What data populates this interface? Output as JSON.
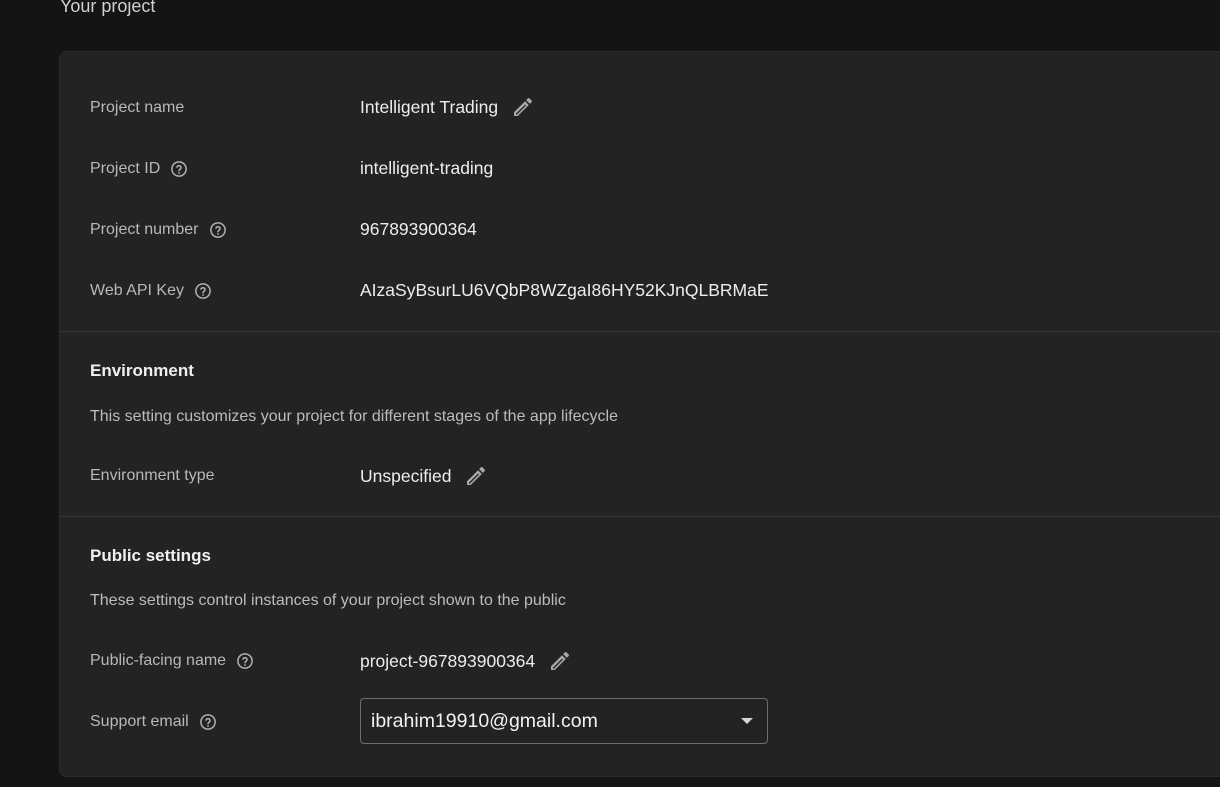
{
  "page": {
    "section_heading": "Your project"
  },
  "project": {
    "name_label": "Project name",
    "name_value": "Intelligent Trading",
    "id_label": "Project ID",
    "id_value": "intelligent-trading",
    "number_label": "Project number",
    "number_value": "967893900364",
    "api_key_label": "Web API Key",
    "api_key_value": "AIzaSyBsurLU6VQbP8WZgaI86HY52KJnQLBRMaE"
  },
  "environment": {
    "title": "Environment",
    "description": "This setting customizes your project for different stages of the app lifecycle",
    "type_label": "Environment type",
    "type_value": "Unspecified"
  },
  "public_settings": {
    "title": "Public settings",
    "description": "These settings control instances of your project shown to the public",
    "public_name_label": "Public-facing name",
    "public_name_value": "project-967893900364",
    "support_email_label": "Support email",
    "support_email_value": "ibrahim19910@gmail.com"
  },
  "icons": {
    "edit": "pencil-icon",
    "help": "help-circle-icon",
    "dropdown": "arrow-drop-down-icon"
  },
  "colors": {
    "background": "#141414",
    "card": "#232323",
    "divider": "#363636",
    "label_text": "#b8b8b8",
    "value_text": "#ededed"
  }
}
